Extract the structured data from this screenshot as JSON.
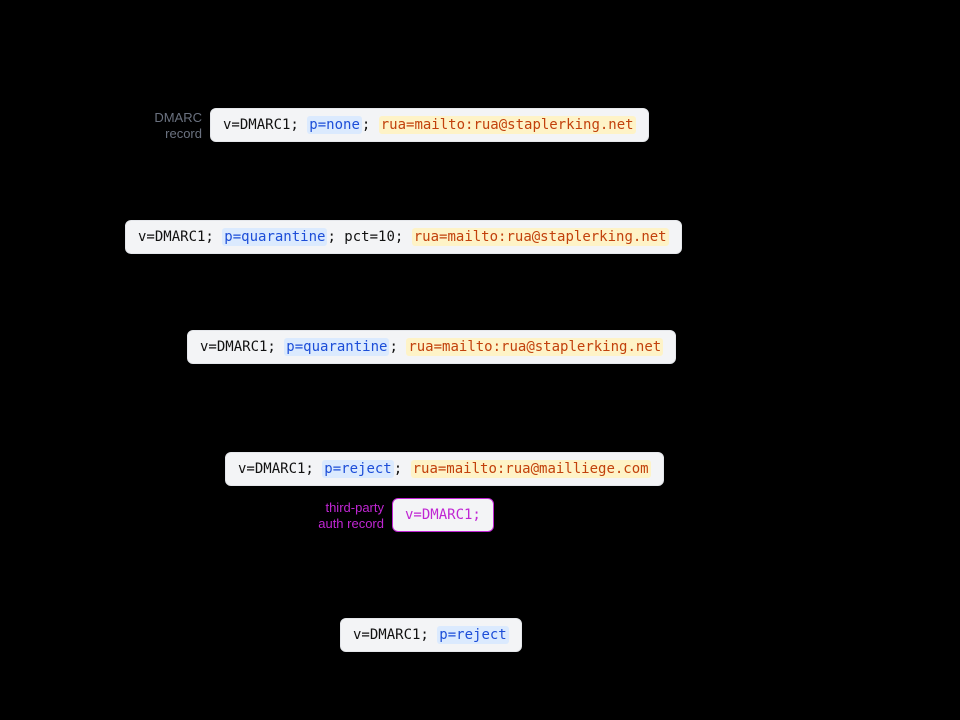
{
  "labels": {
    "dmarc_line1": "DMARC",
    "dmarc_line2": "record",
    "third_line1": "third-party",
    "third_line2": "auth record"
  },
  "records": [
    {
      "prefix": "v=DMARC1; ",
      "policy": "p=none",
      "mid": "; ",
      "rua": "rua=mailto:rua@staplerking.net"
    },
    {
      "prefix": "v=DMARC1; ",
      "policy": "p=quarantine",
      "mid": "; pct=10; ",
      "rua": "rua=mailto:rua@staplerking.net"
    },
    {
      "prefix": "v=DMARC1; ",
      "policy": "p=quarantine",
      "mid": "; ",
      "rua": "rua=mailto:rua@staplerking.net"
    },
    {
      "prefix": "v=DMARC1; ",
      "policy": "p=reject",
      "mid": "; ",
      "rua": "rua=mailto:rua@mailliege.com"
    },
    {
      "prefix": "",
      "policy": "",
      "mid": "",
      "rua": "",
      "raw": "v=DMARC1;"
    },
    {
      "prefix": "v=DMARC1; ",
      "policy": "p=reject",
      "mid": "",
      "rua": ""
    }
  ]
}
